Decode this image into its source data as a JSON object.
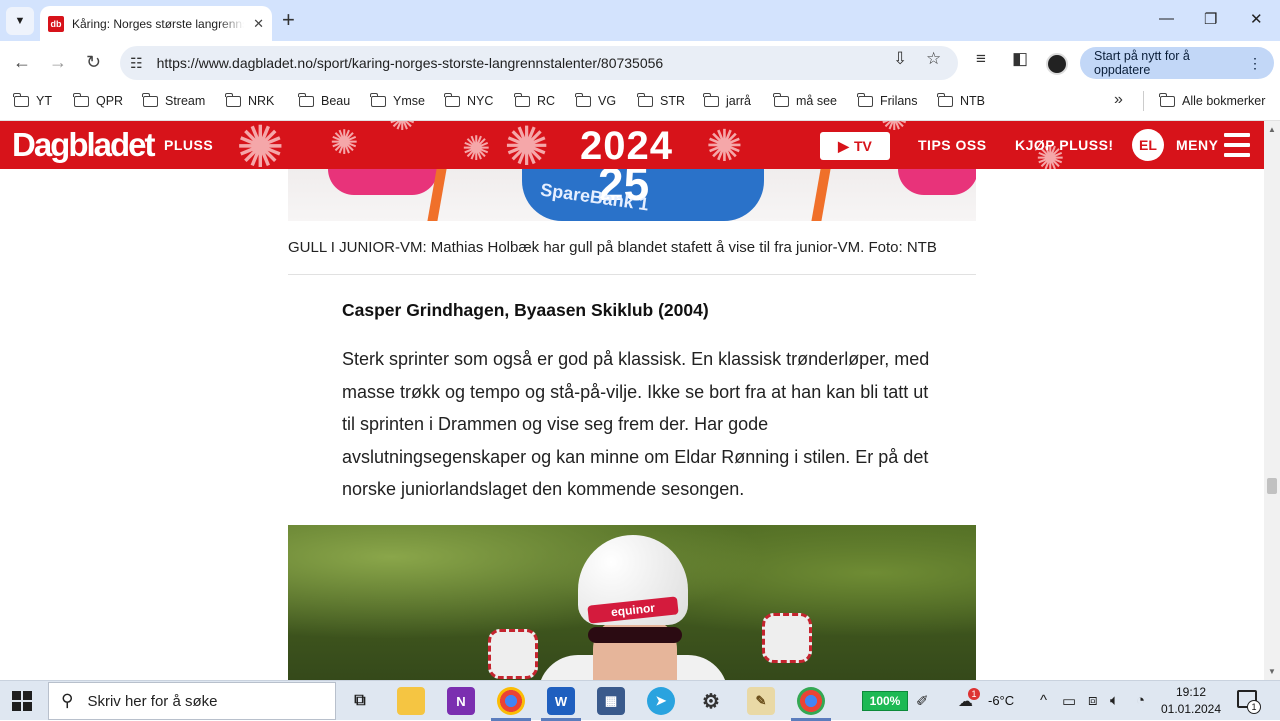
{
  "browser": {
    "tab": {
      "favicon": "db",
      "title": "Kåring: Norges største langrennstalenter",
      "close_icon": "✕"
    },
    "url": "https://www.dagbladet.no/sport/karing-norges-storste-langrennstalenter/80735056",
    "update_button": "Start på nytt for å oppdatere",
    "bookmarks": [
      "YT",
      "QPR",
      "Stream",
      "NRK",
      "Beau",
      "Ymse",
      "NYC",
      "RC",
      "VG",
      "STR",
      "jarrå",
      "må see",
      "Frilans",
      "NTB"
    ],
    "all_bookmarks": "Alle bokmerker"
  },
  "site": {
    "logo": "Dagbladet",
    "pluss": "PLUSS",
    "year": "2024",
    "tv": "TV",
    "tips": "TIPS OSS",
    "buy": "KJØP PLUSS!",
    "user_initials": "EL",
    "menu": "MENY",
    "brand_color": "#d7131a"
  },
  "article": {
    "bib_number": "25",
    "bib_brand": "SpareBank 1",
    "caption": "GULL I JUNIOR-VM: Mathias Holbæk har gull på blandet stafett å vise til fra junior-VM. Foto: NTB",
    "subhead": "Casper Grindhagen, Byaasen Skiklub (2004)",
    "body": "Sterk sprinter som også er god på klassisk. En klassisk trønderløper, med masse trøkk og tempo og stå-på-vilje. Ikke se bort fra at han kan bli tatt ut til sprinten i Drammen og vise seg frem der. Har gode avslutningsegenskaper og kan minne om Eldar Rønning i stilen. Er på det norske juniorlandslaget den kommende sesongen.",
    "helmet_brand": "equinor"
  },
  "taskbar": {
    "search_placeholder": "Skriv her for å søke",
    "battery": "100%",
    "temperature": "-6°C",
    "weather_badge": "1",
    "time": "19:12",
    "date": "01.01.2024",
    "notification_count": "1"
  }
}
